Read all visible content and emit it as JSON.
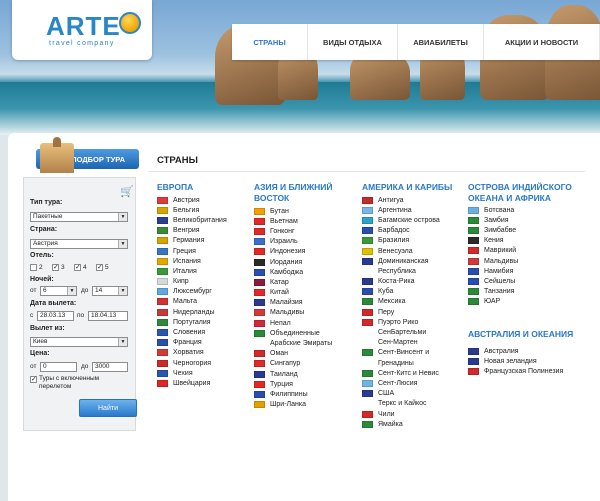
{
  "logo": {
    "text": "ARTE",
    "sub": "travel company"
  },
  "nav": [
    {
      "label": "СТРАНЫ",
      "active": true
    },
    {
      "label": "ВИДЫ ОТДЫХА",
      "active": false
    },
    {
      "label": "АВИАБИЛЕТЫ",
      "active": false
    },
    {
      "label": "АКЦИИ И НОВОСТИ",
      "active": false
    }
  ],
  "sidebar": {
    "badge": "ПОДБОР ТУРА",
    "tour_type_label": "Тип тура:",
    "tour_type_value": "Пакетные",
    "country_label": "Страна:",
    "country_value": "Австрия",
    "hotel_label": "Отель:",
    "stars": [
      {
        "label": "2",
        "checked": false
      },
      {
        "label": "3",
        "checked": true
      },
      {
        "label": "4",
        "checked": true
      },
      {
        "label": "5",
        "checked": true
      }
    ],
    "nights_label": "Ночей:",
    "nights_from_prefix": "от",
    "nights_from": "6",
    "nights_to_prefix": "до",
    "nights_to": "14",
    "departure_label": "Дата вылета:",
    "date_from_prefix": "с",
    "date_from": "28.03.13",
    "date_to_prefix": "по",
    "date_to": "18.04.13",
    "from_label": "Вылет из:",
    "from_value": "Киев",
    "price_label": "Цена:",
    "price_from_prefix": "от",
    "price_from": "0",
    "price_to_prefix": "до",
    "price_to": "3000",
    "flight_checkbox": "Туры с включенным перелетом",
    "search_button": "Найти"
  },
  "content": {
    "title": "СТРАНЫ",
    "columns": [
      {
        "heading": "ЕВРОПА",
        "countries": [
          {
            "name": "Австрия",
            "flag": "#e03a3a"
          },
          {
            "name": "Бельгия",
            "flag": "#d9a400"
          },
          {
            "name": "Великобритания",
            "flag": "#2b3f8c"
          },
          {
            "name": "Венгрия",
            "flag": "#3a8a3a"
          },
          {
            "name": "Германия",
            "flag": "#d8a200"
          },
          {
            "name": "Греция",
            "flag": "#3a75c4"
          },
          {
            "name": "Испания",
            "flag": "#e2a800"
          },
          {
            "name": "Италия",
            "flag": "#3a9a3a"
          },
          {
            "name": "Кипр",
            "flag": "#d8d8d8"
          },
          {
            "name": "Люксембург",
            "flag": "#5fa8e0"
          },
          {
            "name": "Мальта",
            "flag": "#d33030"
          },
          {
            "name": "Нидерланды",
            "flag": "#c63a3a"
          },
          {
            "name": "Португалия",
            "flag": "#2f8a3a"
          },
          {
            "name": "Словения",
            "flag": "#2a56b0"
          },
          {
            "name": "Франция",
            "flag": "#2a4db0"
          },
          {
            "name": "Хорватия",
            "flag": "#d23a3a"
          },
          {
            "name": "Черногория",
            "flag": "#c92b2b"
          },
          {
            "name": "Чехия",
            "flag": "#2a56b0"
          },
          {
            "name": "Швейцария",
            "flag": "#e02525"
          }
        ]
      },
      {
        "heading": "АЗИЯ И БЛИЖНИЙ ВОСТОК",
        "countries": [
          {
            "name": "Бутан",
            "flag": "#f0a000"
          },
          {
            "name": "Вьетнам",
            "flag": "#e02a2a"
          },
          {
            "name": "Гонконг",
            "flag": "#e02a2a"
          },
          {
            "name": "Израиль",
            "flag": "#3a6fd0"
          },
          {
            "name": "Индонезия",
            "flag": "#e02a2a"
          },
          {
            "name": "Иордания",
            "flag": "#2a2a2a"
          },
          {
            "name": "Камбоджа",
            "flag": "#2a4db0"
          },
          {
            "name": "Катар",
            "flag": "#8a1c3a"
          },
          {
            "name": "Китай",
            "flag": "#e02a2a"
          },
          {
            "name": "Малайзия",
            "flag": "#2a3a90"
          },
          {
            "name": "Мальдивы",
            "flag": "#d23a3a"
          },
          {
            "name": "Непал",
            "flag": "#d02a3a"
          },
          {
            "name": "Объединенные",
            "flag": "#2a8a3a"
          },
          {
            "name": "Арабские Эмираты",
            "flag": ""
          },
          {
            "name": "Оман",
            "flag": "#d02a2a"
          },
          {
            "name": "Сингапур",
            "flag": "#e02a2a"
          },
          {
            "name": "Таиланд",
            "flag": "#2a3a90"
          },
          {
            "name": "Турция",
            "flag": "#e02a2a"
          },
          {
            "name": "Филиппины",
            "flag": "#2a4db0"
          },
          {
            "name": "Шри-Ланка",
            "flag": "#e0a000"
          }
        ]
      },
      {
        "heading": "АМЕРИКА И КАРИБЫ",
        "countries": [
          {
            "name": "Антигуа",
            "flag": "#c62a2a"
          },
          {
            "name": "Аргентина",
            "flag": "#7ab4e8"
          },
          {
            "name": "Багамские острова",
            "flag": "#2aa4c8"
          },
          {
            "name": "Барбадос",
            "flag": "#2a4db0"
          },
          {
            "name": "Бразилия",
            "flag": "#3a9a3a"
          },
          {
            "name": "Венесуэла",
            "flag": "#e0c000"
          },
          {
            "name": "Доминиканская",
            "flag": "#2a3a90"
          },
          {
            "name": "Республика",
            "flag": ""
          },
          {
            "name": "Коста-Рика",
            "flag": "#2a3a90"
          },
          {
            "name": "Куба",
            "flag": "#2a4db0"
          },
          {
            "name": "Мексика",
            "flag": "#2a8a3a"
          },
          {
            "name": "Перу",
            "flag": "#d02a2a"
          },
          {
            "name": "Пуэрто Рико",
            "flag": "#d02a2a"
          },
          {
            "name": "СенБартельми",
            "flag": ""
          },
          {
            "name": "Сен-Мартен",
            "flag": ""
          },
          {
            "name": "Сент-Винсент и",
            "flag": "#2a8a3a"
          },
          {
            "name": "Гренадины",
            "flag": ""
          },
          {
            "name": "Сент-Китс и Невис",
            "flag": "#2a8a3a"
          },
          {
            "name": "Сент-Люсия",
            "flag": "#6ab8e0"
          },
          {
            "name": "США",
            "flag": "#2a3a90"
          },
          {
            "name": "Теркс и Кайкос",
            "flag": ""
          },
          {
            "name": "Чили",
            "flag": "#d02a2a"
          },
          {
            "name": "Ямайка",
            "flag": "#2a8a3a"
          }
        ]
      },
      {
        "heading": "ОСТРОВА ИНДИЙСКОГО ОКЕАНА И АФРИКА",
        "countries": [
          {
            "name": "Ботсвана",
            "flag": "#6ab0e0"
          },
          {
            "name": "Замбия",
            "flag": "#2a8a3a"
          },
          {
            "name": "Зимбабве",
            "flag": "#2a8a3a"
          },
          {
            "name": "Кения",
            "flag": "#2a2a2a"
          },
          {
            "name": "Маврикий",
            "flag": "#d02a2a"
          },
          {
            "name": "Мальдивы",
            "flag": "#d23a3a"
          },
          {
            "name": "Намибия",
            "flag": "#2a4db0"
          },
          {
            "name": "Сейшелы",
            "flag": "#2a4db0"
          },
          {
            "name": "Танзания",
            "flag": "#2a8a3a"
          },
          {
            "name": "ЮАР",
            "flag": "#2a8a3a"
          }
        ]
      },
      {
        "heading": "АВСТРАЛИЯ И ОКЕАНИЯ",
        "countries": [
          {
            "name": "Австралия",
            "flag": "#2a3a90"
          },
          {
            "name": "Новая зеландия",
            "flag": "#2a3a90"
          },
          {
            "name": "Французская Полинезия",
            "flag": "#d02a2a"
          }
        ]
      }
    ]
  }
}
